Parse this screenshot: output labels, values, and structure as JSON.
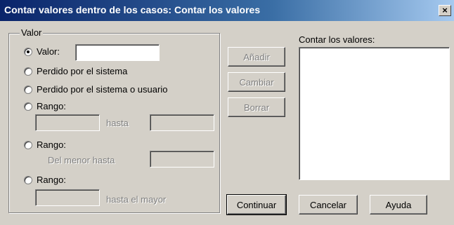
{
  "window": {
    "title": "Contar valores dentro de los casos: Contar los valores",
    "close_glyph": "×"
  },
  "group": {
    "label": "Valor"
  },
  "options": {
    "valor": {
      "label": "Valor:",
      "selected": true
    },
    "perdido_sistema": {
      "label": "Perdido por el sistema",
      "selected": false
    },
    "perdido_usuario": {
      "label": "Perdido por el sistema o usuario",
      "selected": false
    },
    "rango1": {
      "label": "Rango:",
      "selected": false,
      "connector": "hasta"
    },
    "rango2": {
      "label": "Rango:",
      "selected": false,
      "connector": "Del menor hasta"
    },
    "rango3": {
      "label": "Rango:",
      "selected": false,
      "connector": "hasta el mayor"
    }
  },
  "fields": {
    "valor": "",
    "rango1_from": "",
    "rango1_to": "",
    "rango2_to": "",
    "rango3_from": ""
  },
  "buttons": {
    "add": "Añadir",
    "change": "Cambiar",
    "remove": "Borrar",
    "continue": "Continuar",
    "cancel": "Cancelar",
    "help": "Ayuda"
  },
  "values_list": {
    "label": "Contar los valores:",
    "items": []
  }
}
